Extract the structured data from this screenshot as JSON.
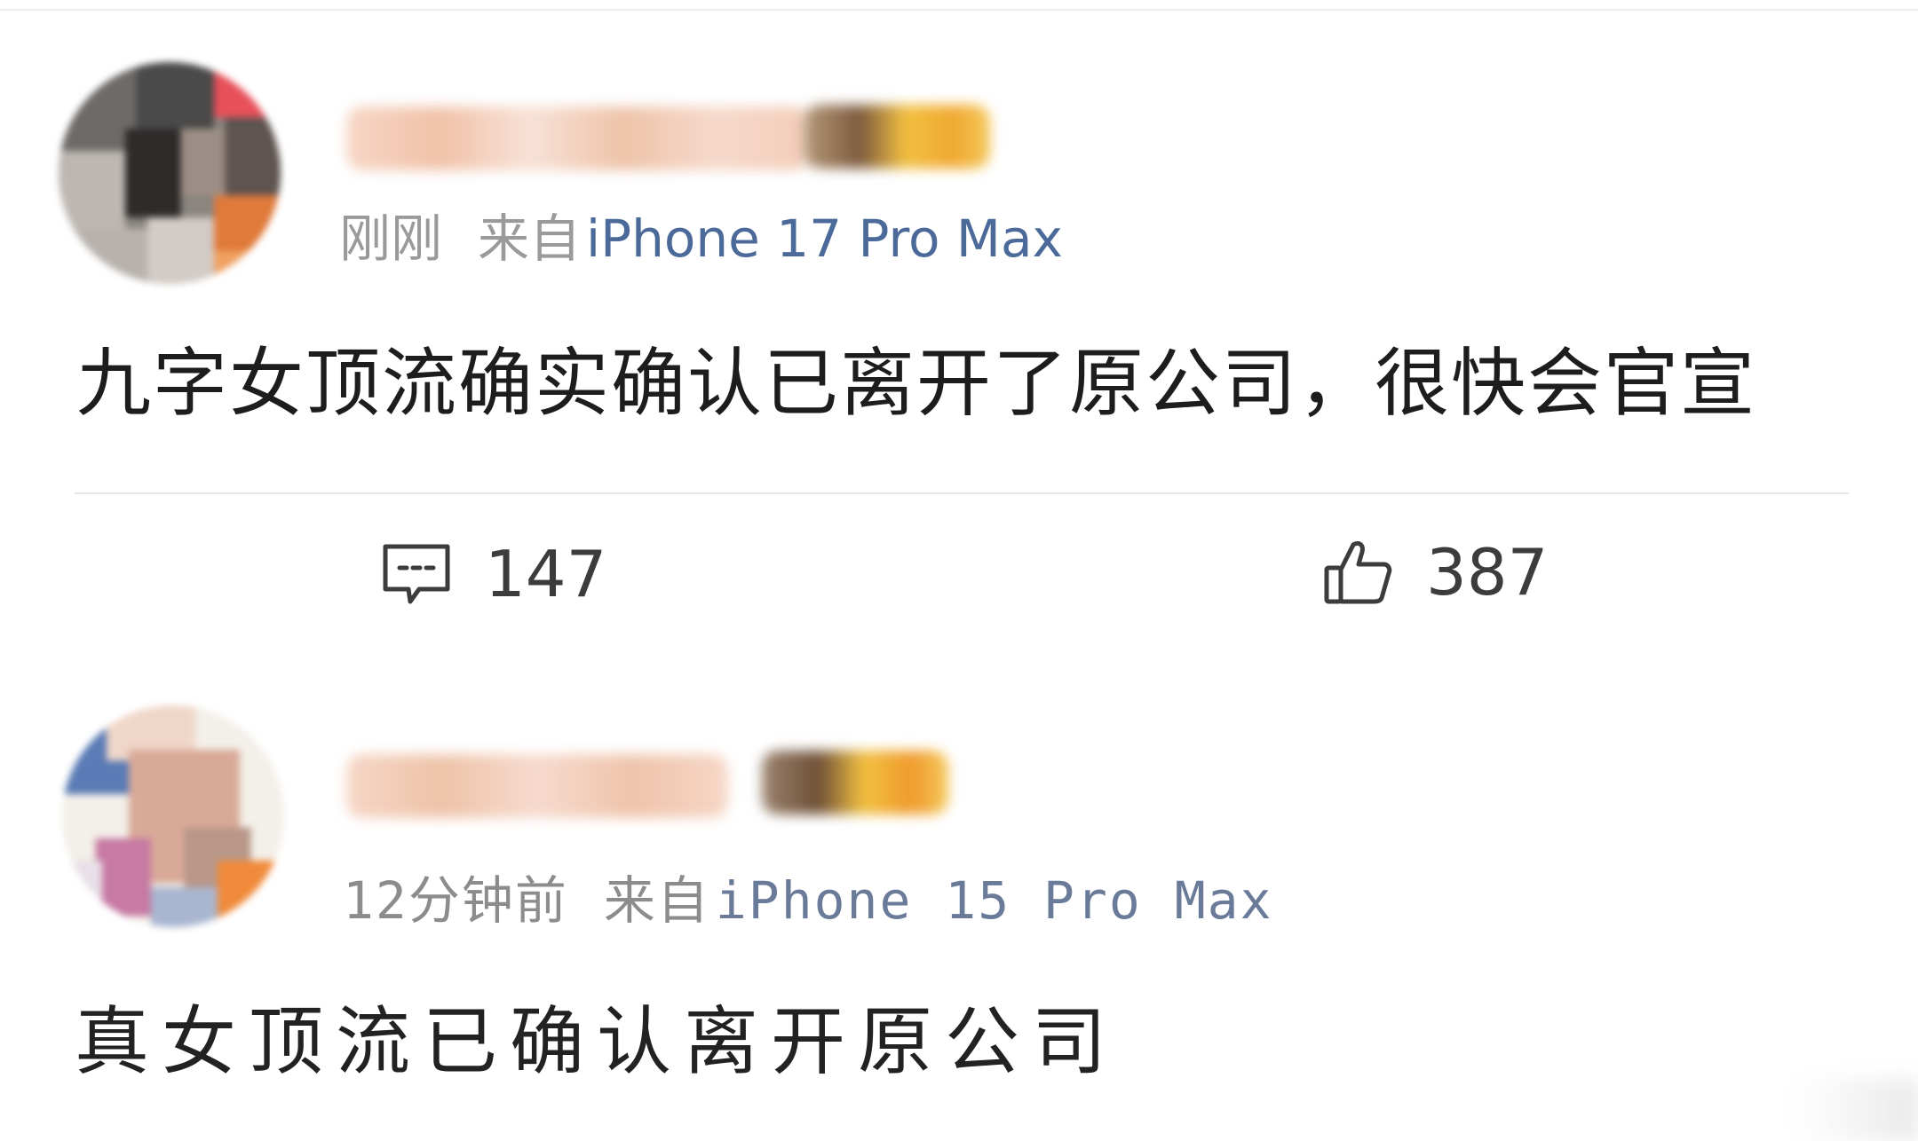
{
  "posts": [
    {
      "time": "刚刚",
      "source_prefix": "来自",
      "device": "iPhone 17 Pro Max",
      "content": "九字女顶流确实确认已离开了原公司，很快会官宣",
      "actions": {
        "comment_count": "147",
        "like_count": "387",
        "comment_icon": "comment-bubble-icon",
        "like_icon": "thumbs-up-icon"
      }
    },
    {
      "time": "12分钟前",
      "source_prefix": "来自",
      "device": "iPhone 15 Pro Max",
      "content": "真女顶流已确认离开原公司"
    }
  ],
  "colors": {
    "meta_gray": "#9a9a9a",
    "device_blue": "#4b6a99",
    "content_text": "#1d1d1d",
    "divider": "#e6e6e6"
  }
}
